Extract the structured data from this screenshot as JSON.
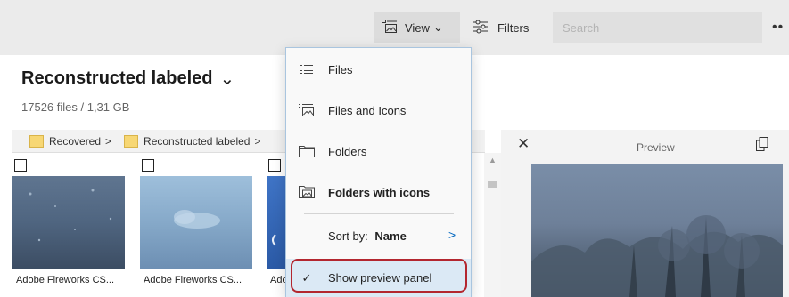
{
  "toolbar": {
    "view_label": "View",
    "view_chevron": "⌄",
    "filters_label": "Filters",
    "search_placeholder": "Search",
    "more_label": "••"
  },
  "header": {
    "title": "Reconstructed labeled",
    "title_chevron": "⌄",
    "summary": "17526 files / 1,31 GB"
  },
  "breadcrumb": [
    {
      "label": "Recovered",
      "separator": ">"
    },
    {
      "label": "Reconstructed labeled",
      "separator": ">"
    }
  ],
  "files": [
    {
      "name": "Adobe Fireworks CS..."
    },
    {
      "name": "Adobe Fireworks CS..."
    },
    {
      "name": "Adobe Fireworks CS..."
    }
  ],
  "preview": {
    "title": "Preview",
    "close_glyph": "✕"
  },
  "view_menu": {
    "items": [
      {
        "label": "Files",
        "icon": "list-icon"
      },
      {
        "label": "Files and Icons",
        "icon": "list-with-image-icon"
      },
      {
        "label": "Folders",
        "icon": "folder-outline-icon"
      },
      {
        "label": "Folders with icons",
        "icon": "folder-image-icon",
        "bold": true
      }
    ],
    "sort": {
      "label": "Sort by:",
      "value": "Name",
      "chevron": ">"
    },
    "preview_toggle": {
      "label": "Show preview panel",
      "checked": true,
      "check_glyph": "✓"
    }
  },
  "colors": {
    "accent": "#0067c0",
    "highlight_ring": "#b3262f",
    "folder": "#f7d774",
    "topbar": "#ebebeb"
  }
}
